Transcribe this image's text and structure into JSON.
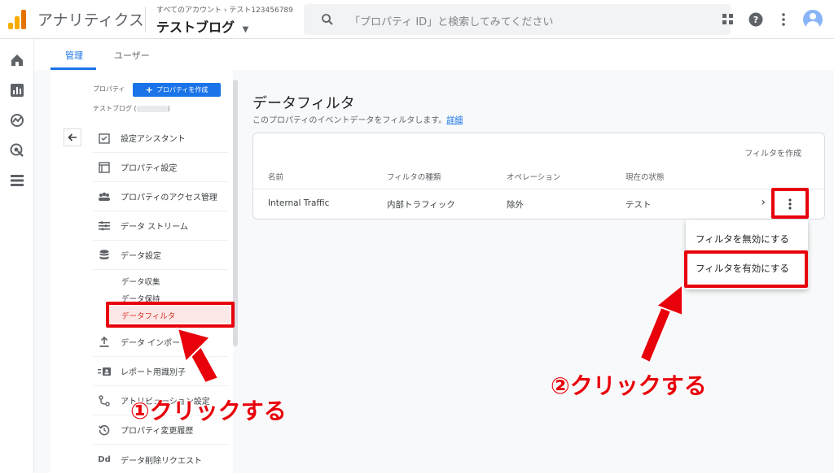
{
  "app": {
    "title": "アナリティクス"
  },
  "account": {
    "breadcrumb": "すべてのアカウント › テスト123456789",
    "property_name": "テストブログ"
  },
  "search": {
    "placeholder": "「プロパティ ID」と検索してみてください"
  },
  "tabs": [
    {
      "label": "管理",
      "active": true
    },
    {
      "label": "ユーザー",
      "active": false
    }
  ],
  "property_panel": {
    "label": "プロパティ",
    "create_button": "プロパティを作成",
    "sub_prefix": "テストブログ (",
    "sub_suffix": ")",
    "menu": [
      {
        "label": "設定アシスタント",
        "icon": "checklist-icon"
      },
      {
        "label": "プロパティ設定",
        "icon": "property-settings-icon"
      },
      {
        "label": "プロパティのアクセス管理",
        "icon": "people-icon"
      },
      {
        "label": "データ ストリーム",
        "icon": "data-stream-icon"
      },
      {
        "label": "データ設定",
        "icon": "database-icon"
      },
      {
        "label": "データ インポート",
        "icon": "upload-icon"
      },
      {
        "label": "レポート用識別子",
        "icon": "identifier-icon"
      },
      {
        "label": "アトリビューション設定",
        "icon": "attribution-icon"
      },
      {
        "label": "プロパティ変更履歴",
        "icon": "history-icon"
      },
      {
        "label": "データ削除リクエスト",
        "icon": "dd-icon",
        "icon_text": "Dd"
      }
    ],
    "data_settings_sub": [
      {
        "label": "データ収集",
        "active": false
      },
      {
        "label": "データ保持",
        "active": false
      },
      {
        "label": "データフィルタ",
        "active": true
      }
    ]
  },
  "main": {
    "title": "データフィルタ",
    "description": "このプロパティのイベントデータをフィルタします。",
    "details_link": "詳細",
    "create_filter": "フィルタを作成",
    "columns": [
      "名前",
      "フィルタの種類",
      "オペレーション",
      "現在の状態"
    ],
    "rows": [
      {
        "name": "Internal Traffic",
        "type": "内部トラフィック",
        "operation": "除外",
        "state": "テスト"
      }
    ]
  },
  "row_menu": {
    "items": [
      "フィルタを無効にする",
      "フィルタを有効にする"
    ]
  },
  "annotations": {
    "step1": "①クリックする",
    "step2": "②クリックする",
    "color": "#e8000b"
  }
}
